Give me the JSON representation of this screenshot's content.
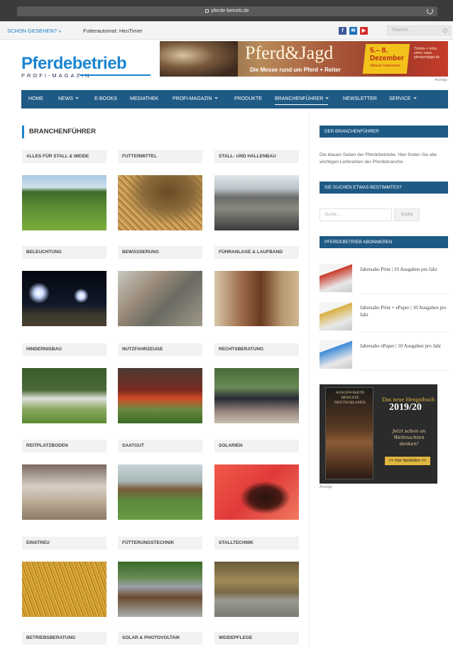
{
  "browser": {
    "url": "pferde-betrieb.de"
  },
  "topbar": {
    "ticker_label": "SCHON GESEHEN? »",
    "ticker_text": "Futterautomat: HeuTimer",
    "social": [
      {
        "icon": "facebook-icon",
        "glyph": "f",
        "color": "#3b5998"
      },
      {
        "icon": "mail-icon",
        "glyph": "✉",
        "color": "#1e73be"
      },
      {
        "icon": "youtube-icon",
        "glyph": "▶",
        "color": "#d62b2b"
      }
    ],
    "search_placeholder": "Search..."
  },
  "logo": {
    "name": "Pferdebetrieb",
    "sub": "PROFI-MAGAZIN"
  },
  "banner": {
    "title": "Pferd&Jagd",
    "subtitle": "Die Messe rund um Pferd + Reiter",
    "date_line1": "5.– 8.",
    "date_line2": "Dezember",
    "date_small": "Messe Hannover",
    "ticket": "Tickets + Infos unter: www. pferdundjagd.de",
    "ad_label": "Anzeige"
  },
  "nav": [
    {
      "label": "HOME",
      "caret": false
    },
    {
      "label": "NEWS",
      "caret": true
    },
    {
      "label": "E-BOOKS",
      "caret": false
    },
    {
      "label": "MEDIATHEK",
      "caret": false
    },
    {
      "label": "PROFI-MAGAZIN",
      "caret": true
    },
    {
      "label": "PRODUKTE",
      "caret": false
    },
    {
      "label": "BRANCHENFÜHRER",
      "caret": true,
      "active": true
    },
    {
      "label": "NEWSLETTER",
      "caret": false
    },
    {
      "label": "SERVICE",
      "caret": true
    }
  ],
  "main": {
    "title": "BRANCHENFÜHRER",
    "categories": [
      {
        "label": "ALLES FÜR STALL & WEIDE",
        "photo": "p-weide"
      },
      {
        "label": "FUTTERMITTEL",
        "photo": "p-futter"
      },
      {
        "label": "STALL- UND HALLENBAU",
        "photo": "p-stall"
      },
      {
        "label": "BELEUCHTUNG",
        "photo": "p-licht"
      },
      {
        "label": "BEWÄSSERUNG",
        "photo": "p-wasser"
      },
      {
        "label": "FÜHRANLAGE & LAUFBAND",
        "photo": "p-fuehr"
      },
      {
        "label": "HINDERNISBAU",
        "photo": "p-hind"
      },
      {
        "label": "NUTZFAHRZEUGE",
        "photo": "p-nutz"
      },
      {
        "label": "RECHTSBERATUNG",
        "photo": "p-recht"
      },
      {
        "label": "REITPLATZBODEN",
        "photo": "p-reit"
      },
      {
        "label": "SAATGUT",
        "photo": "p-saat"
      },
      {
        "label": "SOLARIEN",
        "photo": "p-solar"
      },
      {
        "label": "EINSTREU",
        "photo": "p-einstreu"
      },
      {
        "label": "FÜTTERUNGSTECHNIK",
        "photo": "p-fuett"
      },
      {
        "label": "STALLTECHNIK",
        "photo": "p-stalltech"
      },
      {
        "label": "BETRIEBSBERATUNG",
        "photo": ""
      },
      {
        "label": "SOLAR & PHOTOVOLTAIK",
        "photo": ""
      },
      {
        "label": "WEIDEPFLEGE",
        "photo": ""
      }
    ]
  },
  "sidebar": {
    "about_title": "DER BRANCHENFÜHRER",
    "about_text": "Die blauen Seiten der Pferdebetriebe. Hier finden Sie alle wichtigen Lieferanten der Pferdebranche.",
    "search_title": "SIE SUCHEN ETWAS BESTIMMTES?",
    "search_placeholder": "Suche ...",
    "search_button": "Suche",
    "subscribe_title": "PFERDEBETRIEB ABONNIEREN",
    "subscriptions": [
      {
        "text": "Jahresabo Print | 10 Ausgaben pro Jahr",
        "color": "#c83a2a"
      },
      {
        "text": "Jahresabo Print + ePaper | 10 Ausgaben pro Jahr",
        "color": "#d8b040"
      },
      {
        "text": "Jahresabo ePaper | 10 Ausgaben pro Jahr",
        "color": "#3a8ad8"
      }
    ],
    "ad": {
      "book_title": "AUSGEWÄHLTE HENGSTE DEUTSCHLANDS",
      "headline": "Das neue Hengstbuch",
      "year": "2019/20",
      "handwriting": "Jetzt schon an Weihnachten denken!",
      "button": ">> hier bestellen <<",
      "ad_label": "Anzeige"
    }
  }
}
